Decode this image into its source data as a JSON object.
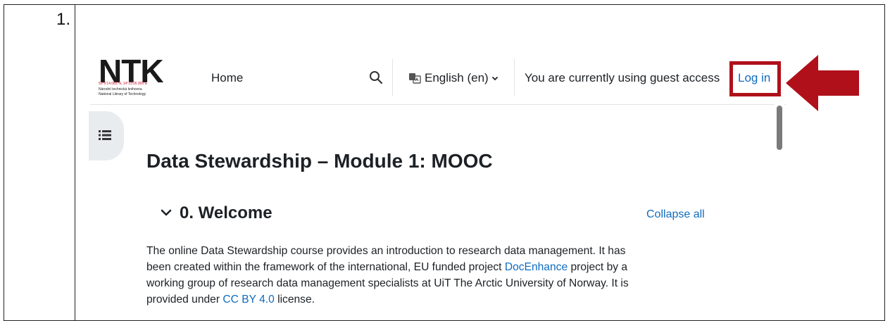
{
  "step": {
    "number": "1."
  },
  "logo": {
    "main": "NTK",
    "coords": "50°6'14.083\"N, 14°23'26.365\"E",
    "line_cz": "Národní technická knihovna",
    "line_en": "National Library of Technology"
  },
  "navbar": {
    "home": "Home",
    "language": "English (en)",
    "guest_text": "You are currently using guest access",
    "login": "Log in"
  },
  "course": {
    "title": "Data Stewardship – Module 1: MOOC",
    "section_title": "0. Welcome",
    "collapse_all": "Collapse all",
    "para": {
      "l1": "The online Data Stewardship course provides an introduction to research data management. It has",
      "l2a": "been created within the framework of the international, EU funded project ",
      "l2_link": "DocEnhance",
      "l2b": " project by a",
      "l3": "working group of research data management specialists at UiT The Arctic University of Norway. It is",
      "l4a": "provided under ",
      "l4_link": "CC BY 4.0",
      "l4b": " license."
    }
  },
  "colors": {
    "accent_link": "#0f6cbf",
    "highlight_red": "#b0101a",
    "logo_red": "#c8102e"
  },
  "icons": {
    "search": "search-icon",
    "language": "language-icon",
    "chevron": "chevron-down-icon",
    "drawer": "course-index-icon",
    "arrow": "arrow-left-icon"
  }
}
